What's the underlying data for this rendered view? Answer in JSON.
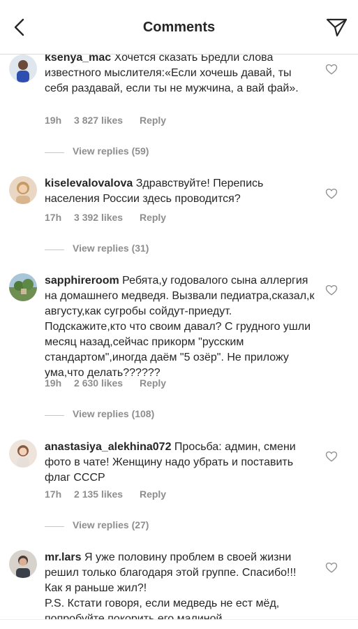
{
  "header": {
    "title": "Comments"
  },
  "comments": [
    {
      "username": "ksenya_mac",
      "text": "Хочется сказать Бредли слова известного мыслителя:«Если хочешь давай, ты себя раздавай, если ты не мужчина, а вай фай».",
      "time": "19h",
      "likes": "3 827 likes",
      "reply": "Reply",
      "view_replies": "View replies (59)"
    },
    {
      "username": "kiselevalovalova",
      "text": "Здравствуйте! Перепись населения России здесь проводится?",
      "time": "17h",
      "likes": "3 392 likes",
      "reply": "Reply",
      "view_replies": "View replies (31)"
    },
    {
      "username": "sapphireroom",
      "text": "Ребята,у годовалого сына аллергия на домашнего медведя. Вызвали педиатра,сказал,к августу,как сугробы сойдут-приедут. Подскажите,кто что своим давал? С грудного ушли месяц назад,сейчас прикорм \"русским стандартом\",иногда даём \"5 озёр\". Не приложу ума,что делать??????",
      "time": "19h",
      "likes": "2 630 likes",
      "reply": "Reply",
      "view_replies": "View replies (108)"
    },
    {
      "username": "anastasiya_alekhina072",
      "text": "Просьба: админ, смени фото в чате! Женщину надо убрать и поставить флаг СССР",
      "time": "17h",
      "likes": "2 135 likes",
      "reply": "Reply",
      "view_replies": "View replies (27)"
    },
    {
      "username": "mr.lars",
      "text": "Я уже половину проблем в своей жизни решил только благодаря этой группе. Спасибо!!! Как я раньше жил?!",
      "text_ps": "P.S. Кстати говоря, если медведь не ест мёд, попробуйте покорить его малиной."
    }
  ],
  "icons": {
    "back": "chevron-left-icon",
    "send": "paper-plane-icon",
    "like": "heart-outline-icon"
  },
  "colors": {
    "text": "#262626",
    "secondary": "#8e8e8e",
    "divider": "#dbdbdb"
  }
}
